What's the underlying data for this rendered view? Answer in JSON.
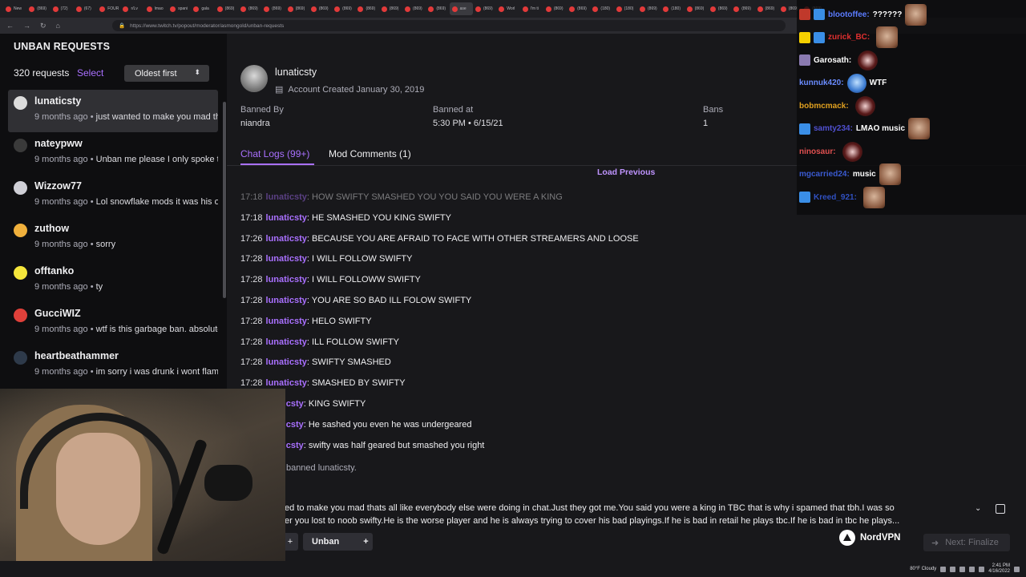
{
  "browser": {
    "tabs": [
      "New",
      "(869)",
      "(72)",
      "(67)",
      "FOUR",
      "r/Lv",
      "lmao",
      "spani",
      "gala",
      "(869)",
      "(869)",
      "(869)",
      "(869)",
      "(869)",
      "(869)",
      "(869)",
      "(869)",
      "(869)",
      "(869)",
      "ase",
      "(869)",
      "Worl",
      "I'm ti",
      "(869)",
      "(869)",
      "(180)",
      "(180)",
      "(869)",
      "(180)",
      "(869)",
      "(869)",
      "(869)",
      "(869)",
      "(869)",
      "(869)"
    ],
    "active_tab_index": 19,
    "url": "https://www.twitch.tv/popout/moderator/asmongold/unban-requests"
  },
  "left_panel": {
    "title": "UNBAN REQUESTS",
    "request_count": "320 requests",
    "select_label": "Select",
    "sort_label": "Oldest first",
    "requests": [
      {
        "username": "lunaticsty",
        "ago": "9 months ago",
        "message": "just wanted to make you mad thats all like everybody",
        "avatar_color": "#dcdcdc",
        "selected": true
      },
      {
        "username": "nateypww",
        "ago": "9 months ago",
        "message": "Unban me please I only spoke the truth",
        "avatar_color": "#3a3a3a",
        "selected": false
      },
      {
        "username": "Wizzow77",
        "ago": "9 months ago",
        "message": "Lol snowflake mods it was his own",
        "avatar_color": "#cfcfd6",
        "selected": false
      },
      {
        "username": "zuthow",
        "ago": "9 months ago",
        "message": "sorry",
        "avatar_color": "#f0b03c",
        "selected": false
      },
      {
        "username": "offtanko",
        "ago": "9 months ago",
        "message": "ty",
        "avatar_color": "#f5e63b",
        "selected": false
      },
      {
        "username": "GucciWIZ",
        "ago": "9 months ago",
        "message": "wtf is this garbage ban. absolutely",
        "avatar_color": "#e0403a",
        "selected": false
      },
      {
        "username": "heartbeathammer",
        "ago": "9 months ago",
        "message": "im sorry i was drunk i wont flame",
        "avatar_color": "#2e3a4a",
        "selected": false
      }
    ]
  },
  "profile": {
    "name": "lunaticsty",
    "account_created": "Account Created January 30, 2019",
    "banned_by_label": "Banned By",
    "banned_by": "niandra",
    "banned_at_label": "Banned at",
    "banned_at": "5:30 PM • 6/15/21",
    "bans_label": "Bans",
    "bans": "1"
  },
  "tabs": {
    "chat_logs": "Chat Logs (99+)",
    "mod_comments": "Mod Comments (1)"
  },
  "load_previous": "Load Previous",
  "chat_logs": [
    {
      "time": "17:18",
      "user": "lunaticsty",
      "text": ": HOW SWIFTY SMASHED YOU YOU SAID YOU WERE A KING",
      "faded": true
    },
    {
      "time": "17:18",
      "user": "lunaticsty",
      "text": ": HE SMASHED YOU KING SWIFTY",
      "faded": false
    },
    {
      "time": "17:26",
      "user": "lunaticsty",
      "text": ": BECAUSE YOU ARE AFRAID TO FACE WITH OTHER STREAMERS AND LOOSE",
      "faded": false
    },
    {
      "time": "17:28",
      "user": "lunaticsty",
      "text": ": I WILL FOLLOW SWIFTY",
      "faded": false
    },
    {
      "time": "17:28",
      "user": "lunaticsty",
      "text": ": I WILL FOLLOWW SWIFTY",
      "faded": false
    },
    {
      "time": "17:28",
      "user": "lunaticsty",
      "text": ": YOU ARE SO BAD ILL FOLOW SWIFTY",
      "faded": false
    },
    {
      "time": "17:28",
      "user": "lunaticsty",
      "text": ": HELO SWIFTY",
      "faded": false
    },
    {
      "time": "17:28",
      "user": "lunaticsty",
      "text": ": ILL FOLLOW SWIFTY",
      "faded": false
    },
    {
      "time": "17:28",
      "user": "lunaticsty",
      "text": ": SWIFTY SMASHED",
      "faded": false
    },
    {
      "time": "17:28",
      "user": "lunaticsty",
      "text": ": SMASHED BY SWIFTY",
      "faded": false
    },
    {
      "time": "",
      "user": "ticsty",
      "text": ": KING SWIFTY",
      "faded": false
    },
    {
      "time": "",
      "user": "ticsty",
      "text": ": He sashed you even he was undergeared",
      "faded": false
    },
    {
      "time": "",
      "user": "ticsty",
      "text": ": swifty was half geared but smashed you right",
      "faded": false
    }
  ],
  "ban_note": "dra banned lunaticsty.",
  "request_message": {
    "line1": "ted to make you mad thats all like everybody else were doing in chat.Just they got me.You said you were a king in TBC that is why i spamed that tbh.I was so",
    "line2": "ter you lost to noob swifty.He is the worse player and he is always trying to cover his bad playings.If he is bad in retail he plays tbc.If he is bad in tbc he plays..."
  },
  "actions": {
    "unban_label": "Unban",
    "plus": "+",
    "next_label": "Next: Finalize",
    "next_arrow": "➜"
  },
  "sponsor": "NordVPN",
  "overlay_chat": [
    {
      "user": "blootoffee:",
      "text": "??????",
      "color": "#5b7cff",
      "badges": [
        "#c0392b",
        "#3a8ee6"
      ],
      "emote": "square"
    },
    {
      "user": "zurick_BC:",
      "text": "",
      "color": "#e03030",
      "badges": [
        "#f5d000",
        "#3a8ee6"
      ],
      "emote": "square"
    },
    {
      "user": "Garosath:",
      "text": "",
      "color": "#ffffff",
      "badges": [
        "#8a7ab0"
      ],
      "emote": "round"
    },
    {
      "user": "kunnuk420:",
      "text": "WTF",
      "color": "#6a8cff",
      "badges": [],
      "emote": "blue"
    },
    {
      "user": "bobmcmack:",
      "text": "",
      "color": "#e0a020",
      "badges": [],
      "emote": "round"
    },
    {
      "user": "samty234:",
      "text": "LMAO music",
      "color": "#5050d0",
      "badges": [
        "#3a8ee6"
      ],
      "emote": "square"
    },
    {
      "user": "ninosaur:",
      "text": "",
      "color": "#e05050",
      "badges": [],
      "emote": "round"
    },
    {
      "user": "mgcarried24:",
      "text": "music",
      "color": "#3a5ad0",
      "badges": [],
      "emote": "square"
    },
    {
      "user": "Kreed_921:",
      "text": "",
      "color": "#3050c0",
      "badges": [
        "#3a8ee6"
      ],
      "emote": "square"
    }
  ],
  "taskbar": {
    "weather": "80°F Cloudy",
    "time": "2:41 PM",
    "date": "4/16/2022"
  }
}
